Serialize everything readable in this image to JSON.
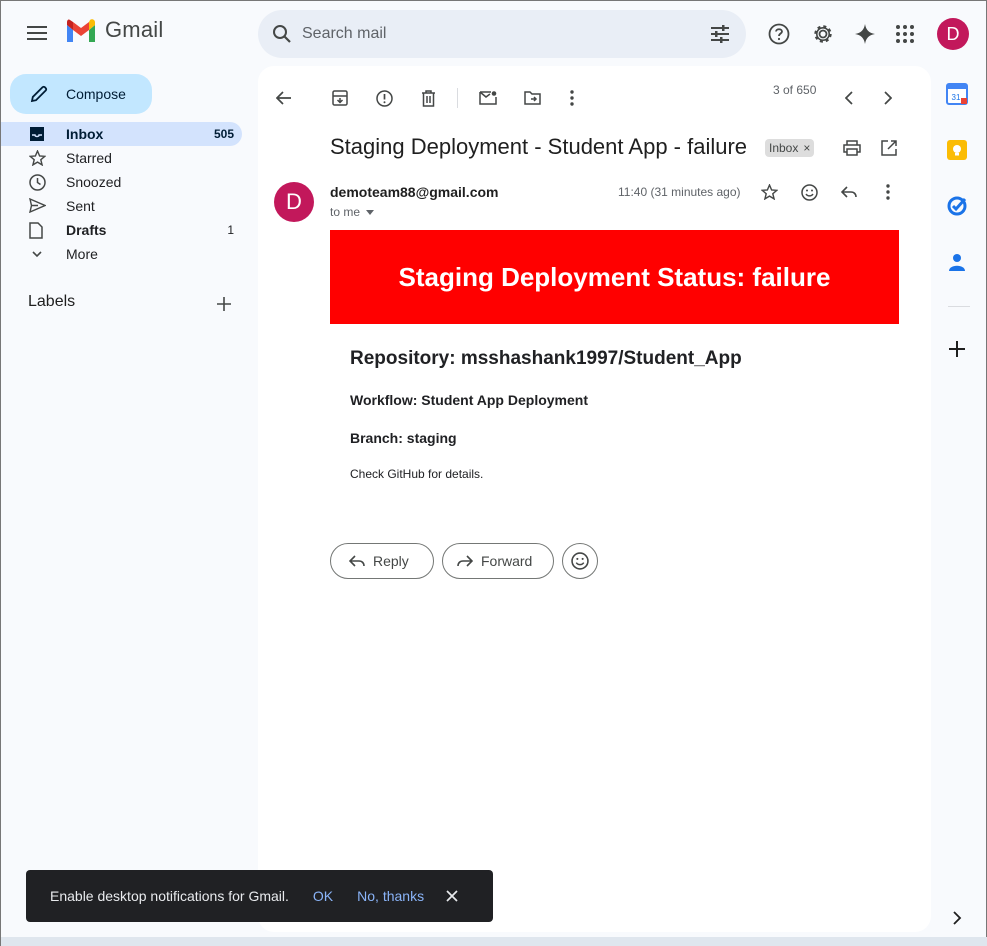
{
  "app": {
    "name": "Gmail",
    "brand_colors": {
      "red": "#ea4335",
      "blue": "#4285f4",
      "green": "#34a853",
      "yellow": "#fbbc04"
    }
  },
  "search": {
    "placeholder": "Search mail"
  },
  "account": {
    "initial": "D",
    "color": "#c2185b"
  },
  "compose": {
    "label": "Compose"
  },
  "sidebar": {
    "items": [
      {
        "label": "Inbox",
        "count": "505",
        "icon": "inbox-icon",
        "active": true
      },
      {
        "label": "Starred",
        "count": "",
        "icon": "star-icon"
      },
      {
        "label": "Snoozed",
        "count": "",
        "icon": "clock-icon"
      },
      {
        "label": "Sent",
        "count": "",
        "icon": "send-icon"
      },
      {
        "label": "Drafts",
        "count": "1",
        "icon": "draft-icon"
      },
      {
        "label": "More",
        "count": "",
        "icon": "chevron-down-icon"
      }
    ],
    "labels_title": "Labels"
  },
  "toolbar": {
    "pager": "3 of 650"
  },
  "email": {
    "subject": "Staging Deployment - Student App - failure",
    "label_chip": "Inbox",
    "label_chip_close": "×",
    "sender_initial": "D",
    "sender": "demoteam88@gmail.com",
    "to": "to me",
    "time": "11:40 (31 minutes ago)",
    "banner": {
      "text": "Staging Deployment Status: failure",
      "color": "#ff0000"
    },
    "repository": "Repository: msshashank1997/Student_App",
    "workflow": "Workflow: Student App Deployment",
    "branch": "Branch: staging",
    "details": "Check GitHub for details."
  },
  "actions": {
    "reply": "Reply",
    "forward": "Forward"
  },
  "snackbar": {
    "message": "Enable desktop notifications for Gmail.",
    "ok": "OK",
    "no_thanks": "No, thanks"
  },
  "right_rail": {
    "calendar_day": "31"
  }
}
